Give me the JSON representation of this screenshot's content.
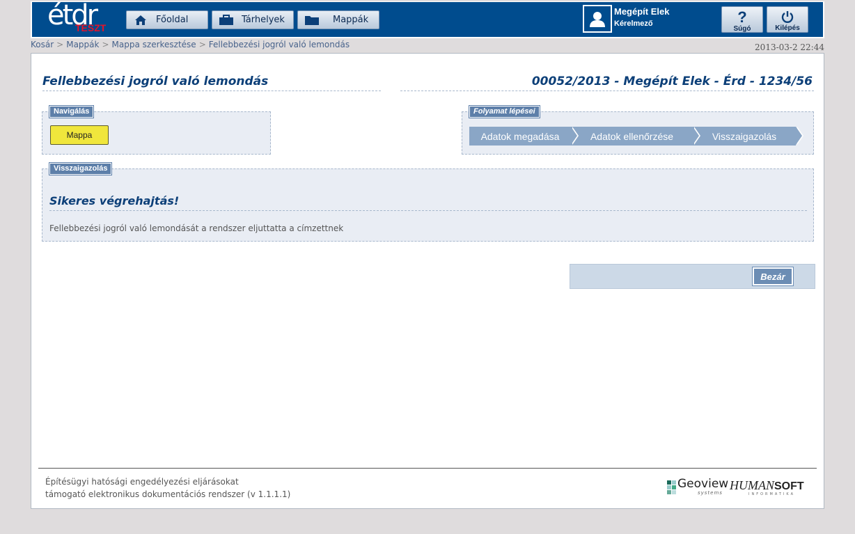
{
  "header": {
    "logo_text": "étdr",
    "logo_badge": "TESZT",
    "nav": [
      {
        "label": "Főoldal",
        "icon": "home-icon"
      },
      {
        "label": "Tárhelyek",
        "icon": "briefcase-icon"
      },
      {
        "label": "Mappák",
        "icon": "folder-icon"
      }
    ],
    "user_name": "Megépít Elek",
    "user_role": "Kérelmező",
    "help_label": "Súgó",
    "logout_label": "Kilépés"
  },
  "breadcrumb": [
    "Kosár",
    "Mappák",
    "Mappa szerkesztése",
    "Fellebbezési jogról való lemondás"
  ],
  "datetime": "2013-03-2 22:44",
  "page": {
    "title": "Fellebbezési jogról való lemondás",
    "case_id": "00052/2013 - Megépít Elek - Érd - 1234/56"
  },
  "navigation": {
    "legend": "Navigálás",
    "mappa_button": "Mappa"
  },
  "process": {
    "legend": "Folyamat lépései",
    "steps": [
      "Adatok megadása",
      "Adatok ellenőrzése",
      "Visszaigazolás"
    ]
  },
  "confirmation": {
    "legend": "Visszaigazolás",
    "title": "Sikeres végrehajtás!",
    "message": "Fellebbezési jogról való lemondását a rendszer eljuttatta a címzettnek"
  },
  "close_button": "Bezár",
  "footer": {
    "line1": "Építésügyi hatósági engedélyezési eljárásokat",
    "line2": "támogató elektronikus dokumentációs rendszer (v 1.1.1.1)",
    "geoview": "Geoview",
    "geoview_sub": "systems",
    "humansoft_a": "HUMAN",
    "humansoft_b": "SOFT",
    "humansoft_sub": "INFORMATIKA"
  },
  "colors": {
    "brand_blue": "#004c8e",
    "step_blue": "#8aa6c6",
    "mappa_yellow": "#f0e63c",
    "teszt_red": "#e4142a"
  }
}
